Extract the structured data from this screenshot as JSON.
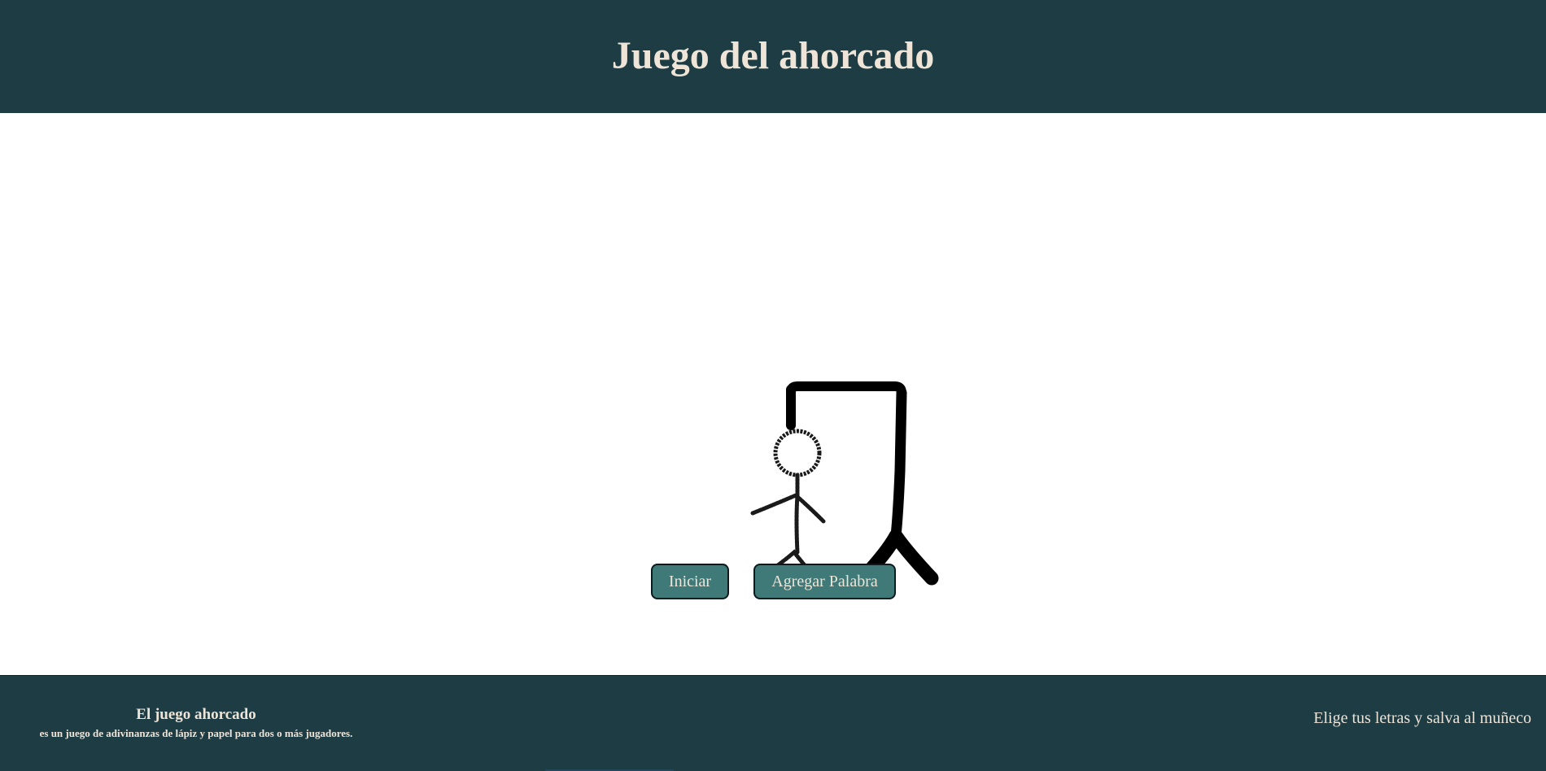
{
  "header": {
    "title": "Juego del ahorcado"
  },
  "hangman": {
    "figure": "hangman-drawing",
    "stroke_color": "#000000"
  },
  "buttons": {
    "start_label": "Iniciar",
    "add_word_label": "Agregar Palabra"
  },
  "footer": {
    "title": "El juego ahorcado",
    "subtitle": "es un juego de adivinanzas de lápiz y papel para dos o más jugadores.",
    "tagline": "Elige tus letras y salva al muñeco"
  },
  "colors": {
    "header_bg": "#1d3c43",
    "button_bg": "#3f7a79",
    "text_light": "#eee4d8"
  }
}
